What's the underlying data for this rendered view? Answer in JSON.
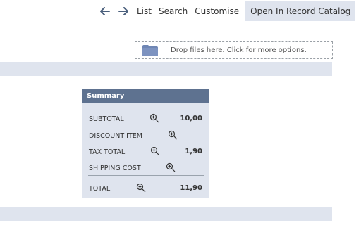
{
  "toolbar": {
    "back_icon": "arrow-left-icon",
    "forward_icon": "arrow-right-icon",
    "list_label": "List",
    "search_label": "Search",
    "customise_label": "Customise",
    "open_catalog_label": "Open In Record Catalog"
  },
  "dropzone": {
    "icon": "folder-icon",
    "text": "Drop files here. Click for more options."
  },
  "summary": {
    "title": "Summary",
    "zoom_icon": "zoom-in-icon",
    "rows": {
      "subtotal": {
        "label": "SUBTOTAL",
        "value": "10,00"
      },
      "discount": {
        "label": "DISCOUNT ITEM",
        "value": ""
      },
      "tax": {
        "label": "TAX TOTAL",
        "value": "1,90"
      },
      "shipping": {
        "label": "SHIPPING COST",
        "value": ""
      },
      "total": {
        "label": "TOTAL",
        "value": "11,90"
      }
    }
  },
  "colors": {
    "band": "#dfe4ee",
    "header": "#5e7290",
    "accent_arrow": "#4a5f7c"
  }
}
